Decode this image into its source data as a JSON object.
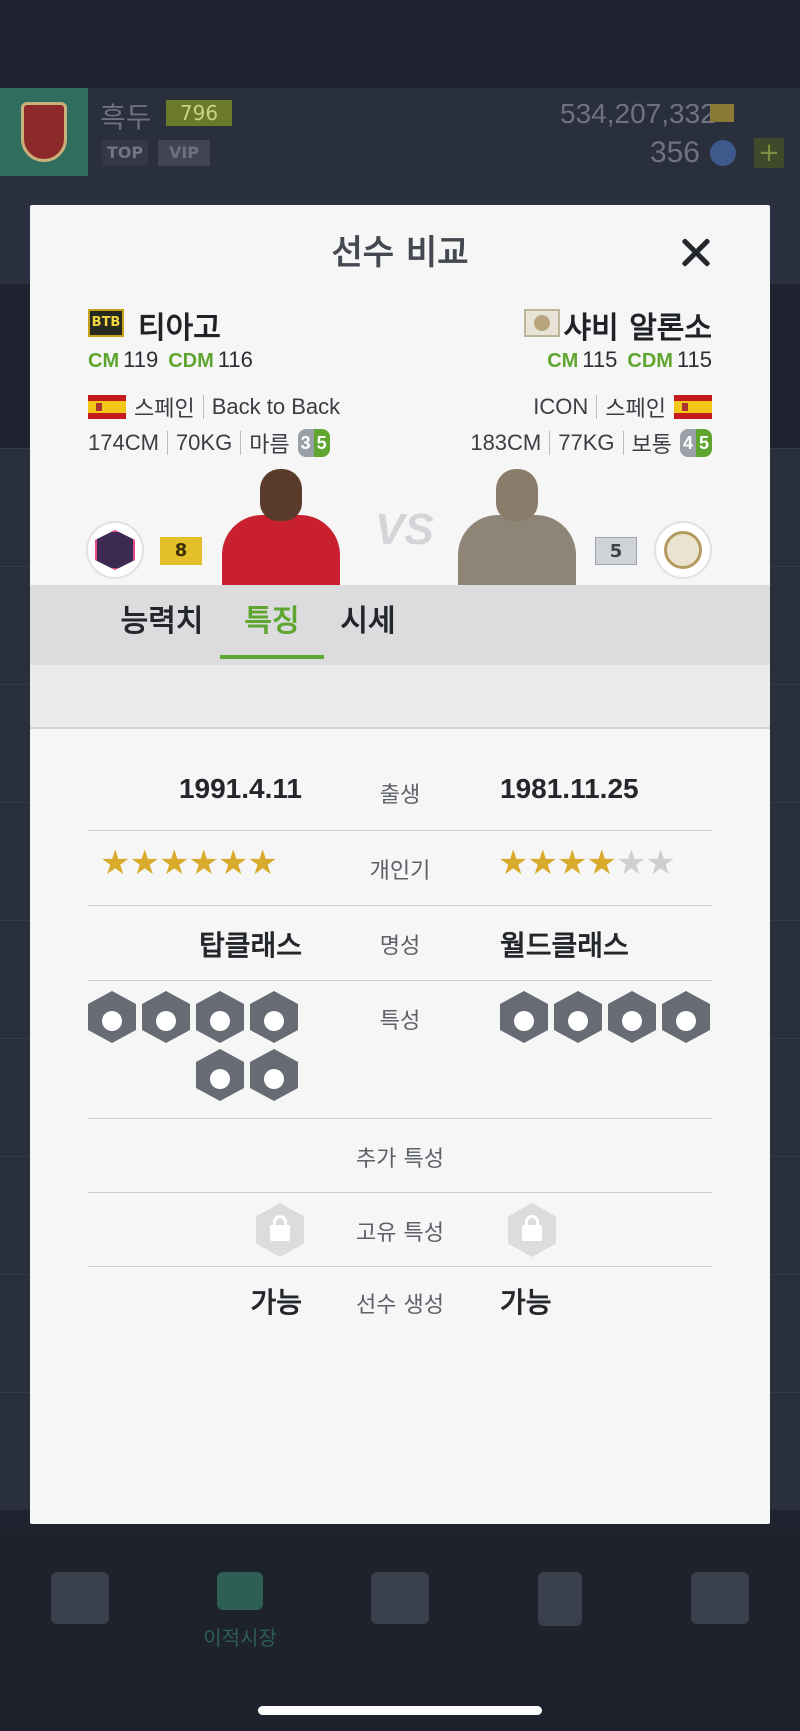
{
  "background": {
    "username": "흑두",
    "level": "796",
    "top_badge": "TOP",
    "vip_badge": "VIP",
    "money": "534,207,332",
    "coins": "356",
    "nav": [
      {
        "label": "",
        "icon": "cart-icon"
      },
      {
        "label": "이적시장",
        "icon": "transfer-icon"
      },
      {
        "label": "",
        "icon": "home-icon"
      },
      {
        "label": "",
        "icon": "pitch-icon"
      },
      {
        "label": "",
        "icon": "locker-icon"
      }
    ]
  },
  "modal": {
    "title": "선수 비교",
    "left": {
      "name": "티아고",
      "season": "BTB",
      "pos1": "CM",
      "ovr1": "119",
      "pos2": "CDM",
      "ovr2": "116",
      "nation": "스페인",
      "season_name": "Back to Back",
      "height": "174CM",
      "weight": "70KG",
      "build": "마름",
      "skill_weak": "3",
      "skill_strong": "5",
      "grade": "8"
    },
    "right": {
      "name": "샤비 알론소",
      "season": "ICON",
      "pos1": "CM",
      "ovr1": "115",
      "pos2": "CDM",
      "ovr2": "115",
      "nation": "스페인",
      "season_name": "ICON",
      "height": "183CM",
      "weight": "77KG",
      "build": "보통",
      "skill_weak": "4",
      "skill_strong": "5",
      "grade": "5"
    },
    "vs": "VS",
    "tabs": [
      "능력치",
      "특징",
      "시세"
    ],
    "active_tab": "특징",
    "rows": {
      "birth": {
        "label": "출생",
        "left": "1991.4.11",
        "right": "1981.11.25"
      },
      "popularity": {
        "label": "개인기",
        "left_stars": 6,
        "left_max": 6,
        "right_stars": 4,
        "right_max": 6
      },
      "fame": {
        "label": "명성",
        "left": "탑클래스",
        "right": "월드클래스"
      },
      "traits": {
        "label": "특성",
        "left_count": 6,
        "right_count": 4
      },
      "extra_traits": {
        "label": "추가 특성"
      },
      "unique_traits": {
        "label": "고유 특성"
      },
      "creation": {
        "label": "선수 생성",
        "left": "가능",
        "right": "가능"
      }
    }
  },
  "colors": {
    "accent_green": "#5ea630",
    "star_gold": "#d9ab2c",
    "grade_gold": "#e3c02a"
  }
}
